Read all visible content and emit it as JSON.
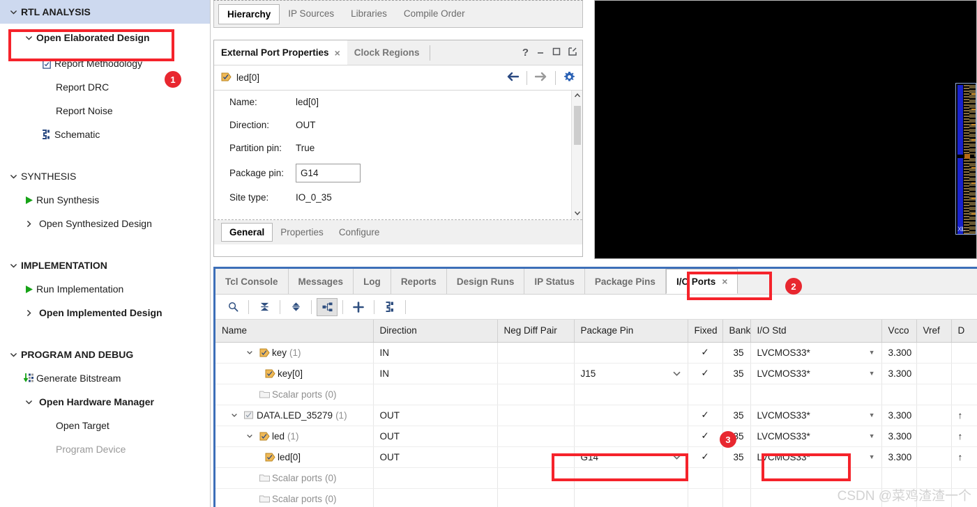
{
  "flow_navigator": {
    "sections": [
      {
        "label": "RTL ANALYSIS",
        "caret": "chevron-down-icon",
        "selected": true,
        "items": [
          {
            "label": "Open Elaborated Design",
            "caret": "chevron-down-icon",
            "bold": true,
            "icon": "",
            "indent": 1,
            "highlighted": true
          },
          {
            "label": "Report Methodology",
            "caret": "",
            "bold": false,
            "icon": "clipboard-check-icon",
            "indent": 2
          },
          {
            "label": "Report DRC",
            "caret": "",
            "bold": false,
            "icon": "",
            "indent": 2
          },
          {
            "label": "Report Noise",
            "caret": "",
            "bold": false,
            "icon": "",
            "indent": 2
          },
          {
            "label": "Schematic",
            "caret": "",
            "bold": false,
            "icon": "schematic-icon",
            "indent": 2
          }
        ]
      },
      {
        "label": "SYNTHESIS",
        "caret": "chevron-down-icon",
        "selected": false,
        "items": [
          {
            "label": "Run Synthesis",
            "caret": "",
            "bold": false,
            "icon": "green-play-icon",
            "indent": 1
          },
          {
            "label": "Open Synthesized Design",
            "caret": "chevron-right-icon",
            "bold": false,
            "icon": "",
            "indent": 1
          }
        ]
      },
      {
        "label": "IMPLEMENTATION",
        "caret": "chevron-down-icon",
        "selected": false,
        "items": [
          {
            "label": "Run Implementation",
            "caret": "",
            "bold": false,
            "icon": "green-play-icon",
            "indent": 1
          },
          {
            "label": "Open Implemented Design",
            "caret": "chevron-right-icon",
            "bold": true,
            "icon": "",
            "indent": 1
          }
        ]
      },
      {
        "label": "PROGRAM AND DEBUG",
        "caret": "chevron-down-icon",
        "selected": false,
        "items": [
          {
            "label": "Generate Bitstream",
            "caret": "",
            "bold": false,
            "icon": "bitstream-icon",
            "indent": 1
          },
          {
            "label": "Open Hardware Manager",
            "caret": "chevron-down-icon",
            "bold": true,
            "icon": "",
            "indent": 1
          },
          {
            "label": "Open Target",
            "caret": "",
            "bold": false,
            "icon": "",
            "indent": 2
          },
          {
            "label": "Program Device",
            "caret": "",
            "bold": false,
            "icon": "",
            "indent": 2,
            "disabled": true
          }
        ]
      }
    ]
  },
  "sources_tabs": {
    "tabs": [
      "Hierarchy",
      "IP Sources",
      "Libraries",
      "Compile Order"
    ],
    "active": "Hierarchy"
  },
  "external_port_properties": {
    "tab_title": "External Port Properties",
    "close_glyph": "×",
    "secondary_tab": "Clock Regions",
    "window_buttons": [
      "help-icon",
      "minimize-icon",
      "maximize-icon",
      "float-icon"
    ],
    "selected_port": "led[0]",
    "nav": {
      "back": "back-arrow-icon",
      "forward": "forward-arrow-icon",
      "settings": "gear-icon"
    },
    "properties": [
      {
        "key": "Name:",
        "value": "led[0]",
        "editable": false
      },
      {
        "key": "Direction:",
        "value": "OUT",
        "editable": false
      },
      {
        "key": "Partition pin:",
        "value": "True",
        "editable": false
      },
      {
        "key": "Package pin:",
        "value": "G14",
        "editable": true
      },
      {
        "key": "Site type:",
        "value": "IO_0_35",
        "editable": false
      }
    ],
    "footer_tabs": [
      "General",
      "Properties",
      "Configure"
    ],
    "footer_active": "General"
  },
  "device_view": {
    "minimap_label": "XIL"
  },
  "dock": {
    "tabs": [
      {
        "label": "Tcl Console",
        "active": false
      },
      {
        "label": "Messages",
        "active": false
      },
      {
        "label": "Log",
        "active": false
      },
      {
        "label": "Reports",
        "active": false
      },
      {
        "label": "Design Runs",
        "active": false
      },
      {
        "label": "IP Status",
        "active": false
      },
      {
        "label": "Package Pins",
        "active": false
      },
      {
        "label": "I/O Ports",
        "active": true,
        "closable": true,
        "close_glyph": "×"
      }
    ],
    "toolbar": [
      {
        "name": "search-icon",
        "pressed": false
      },
      {
        "name": "collapse-all-icon",
        "pressed": false
      },
      {
        "name": "expand-all-icon",
        "pressed": false
      },
      {
        "name": "group-icon",
        "pressed": true
      },
      {
        "name": "add-icon",
        "pressed": false
      },
      {
        "name": "schematic-icon",
        "pressed": false
      }
    ],
    "table": {
      "columns": [
        "Name",
        "Direction",
        "Neg Diff Pair",
        "Package Pin",
        "Fixed",
        "Bank",
        "I/O Std",
        "Vcco",
        "Vref",
        "D"
      ],
      "rows": [
        {
          "name": "key",
          "count": "(1)",
          "indent": 1,
          "caret": "chevron-down-icon",
          "icon": "input-port-icon",
          "direction": "IN",
          "neg_diff_pair": "",
          "package_pin": "",
          "package_pin_dropdown": false,
          "fixed": "✓",
          "bank": "35",
          "io_std": "LVCMOS33*",
          "io_std_dropdown": true,
          "vcco": "3.300",
          "vref": "",
          "drive": ""
        },
        {
          "name": "key[0]",
          "count": "",
          "indent": 2,
          "caret": "",
          "icon": "input-port-icon",
          "direction": "IN",
          "neg_diff_pair": "",
          "package_pin": "J15",
          "package_pin_dropdown": true,
          "fixed": "✓",
          "bank": "35",
          "io_std": "LVCMOS33*",
          "io_std_dropdown": true,
          "vcco": "3.300",
          "vref": "",
          "drive": ""
        },
        {
          "name": "Scalar ports",
          "count": "(0)",
          "indent": 2,
          "caret": "",
          "icon": "folder-icon",
          "direction": "",
          "neg_diff_pair": "",
          "package_pin": "",
          "package_pin_dropdown": false,
          "fixed": "",
          "bank": "",
          "io_std": "",
          "io_std_dropdown": false,
          "vcco": "",
          "vref": "",
          "drive": "",
          "muted": true
        },
        {
          "name": "DATA.LED_35279",
          "count": "(1)",
          "indent": 0,
          "caret": "chevron-down-icon",
          "icon": "bus-icon",
          "direction": "OUT",
          "neg_diff_pair": "",
          "package_pin": "",
          "package_pin_dropdown": false,
          "fixed": "✓",
          "bank": "35",
          "io_std": "LVCMOS33*",
          "io_std_dropdown": true,
          "vcco": "3.300",
          "vref": "",
          "drive": "↑"
        },
        {
          "name": "led",
          "count": "(1)",
          "indent": 1,
          "caret": "chevron-down-icon",
          "icon": "output-port-icon",
          "direction": "OUT",
          "neg_diff_pair": "",
          "package_pin": "",
          "package_pin_dropdown": false,
          "fixed": "✓",
          "bank": "35",
          "io_std": "LVCMOS33*",
          "io_std_dropdown": true,
          "vcco": "3.300",
          "vref": "",
          "drive": "↑"
        },
        {
          "name": "led[0]",
          "count": "",
          "indent": 2,
          "caret": "",
          "icon": "output-port-icon",
          "direction": "OUT",
          "neg_diff_pair": "",
          "package_pin": "G14",
          "package_pin_dropdown": true,
          "fixed": "✓",
          "bank": "35",
          "io_std": "LVCMOS33*",
          "io_std_dropdown": true,
          "vcco": "3.300",
          "vref": "",
          "drive": "↑"
        },
        {
          "name": "Scalar ports",
          "count": "(0)",
          "indent": 2,
          "caret": "",
          "icon": "folder-icon",
          "direction": "",
          "neg_diff_pair": "",
          "package_pin": "",
          "package_pin_dropdown": false,
          "fixed": "",
          "bank": "",
          "io_std": "",
          "io_std_dropdown": false,
          "vcco": "",
          "vref": "",
          "drive": "",
          "muted": true
        },
        {
          "name": "Scalar ports",
          "count": "(0)",
          "indent": 2,
          "caret": "",
          "icon": "folder-icon",
          "direction": "",
          "neg_diff_pair": "",
          "package_pin": "",
          "package_pin_dropdown": false,
          "fixed": "",
          "bank": "",
          "io_std": "",
          "io_std_dropdown": false,
          "vcco": "",
          "vref": "",
          "drive": "",
          "muted": true
        }
      ]
    }
  },
  "annotations": {
    "badges": [
      "1",
      "2",
      "3"
    ],
    "highlight_color": "#f5232b"
  },
  "watermark": "CSDN @菜鸡渣渣一个"
}
